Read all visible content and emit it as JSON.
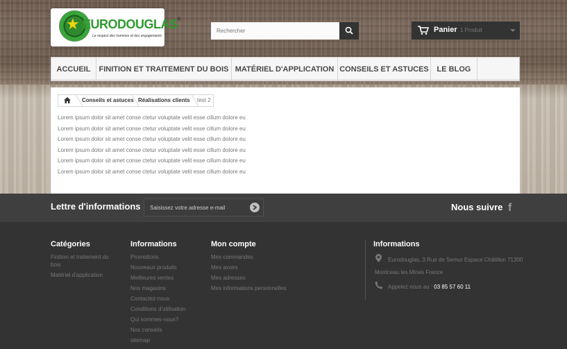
{
  "logo": {
    "name": "EURODOUGLAS",
    "registered": "®",
    "tagline": "Le respect des hommes et des engagements"
  },
  "search": {
    "placeholder": "Rechercher"
  },
  "cart": {
    "label": "Panier",
    "count": "1 Produit"
  },
  "nav": {
    "items": [
      {
        "label": "ACCUEIL"
      },
      {
        "label": "FINITION ET TRAITEMENT DU BOIS"
      },
      {
        "label": "MATÉRIEL D'APPLICATION"
      },
      {
        "label": "CONSEILS ET ASTUCES"
      },
      {
        "label": "LE BLOG"
      }
    ]
  },
  "breadcrumb": {
    "items": [
      "Conseils et astuces",
      "Réalisations clients"
    ],
    "current": "test 2"
  },
  "content": {
    "paragraphs": [
      "Lorem ipsum dolor sit amet conse ctetur voluptate velit esse cillum dolore eu",
      "Lorem ipsum dolor sit amet conse ctetur voluptate velit esse cillum dolore eu",
      "Lorem ipsum dolor sit amet conse ctetur voluptate velit esse cillum dolore eu",
      "Lorem ipsum dolor sit amet conse ctetur voluptate velit esse cillum dolore eu",
      "Lorem ipsum dolor sit amet conse ctetur voluptate velit esse cillum dolore eu",
      "Lorem ipsum dolor sit amet conse ctetur voluptate velit esse cillum dolore eu"
    ]
  },
  "newsletter": {
    "title": "Lettre d'informations",
    "placeholder": "Saisissez votre adresse e-mail"
  },
  "follow": {
    "title": "Nous suivre",
    "facebook_glyph": "f"
  },
  "footer": {
    "categories": {
      "title": "Catégories",
      "links": [
        "Finition et traitement du",
        "bois",
        "Matériel d'application"
      ]
    },
    "informations": {
      "title": "Informations",
      "links": [
        "Promotions",
        "Nouveaux produits",
        "Meilleures ventes",
        "Nos magasins",
        "Contactez-nous",
        "Conditions d'utilisation",
        "Qui sommes-nous?",
        "Nos conseils",
        "sitemap"
      ]
    },
    "account": {
      "title": "Mon compte",
      "links": [
        "Mes commandes",
        "Mes avoirs",
        "Mes adresses",
        "Mes informations personnelles"
      ]
    },
    "store": {
      "title": "Informations",
      "address_line1": "Eurodouglas, 3 Rue de Semur Espace Châtillon 71300",
      "address_line2": "Montceau les Mines France",
      "phone_label": "Appelez nous au :",
      "phone": "03 85 57 60 11"
    }
  },
  "colors": {
    "dark": "#333333",
    "footer": "#333333",
    "newsletter": "#3f3f3f",
    "logo_green": "#2f9a2f"
  }
}
